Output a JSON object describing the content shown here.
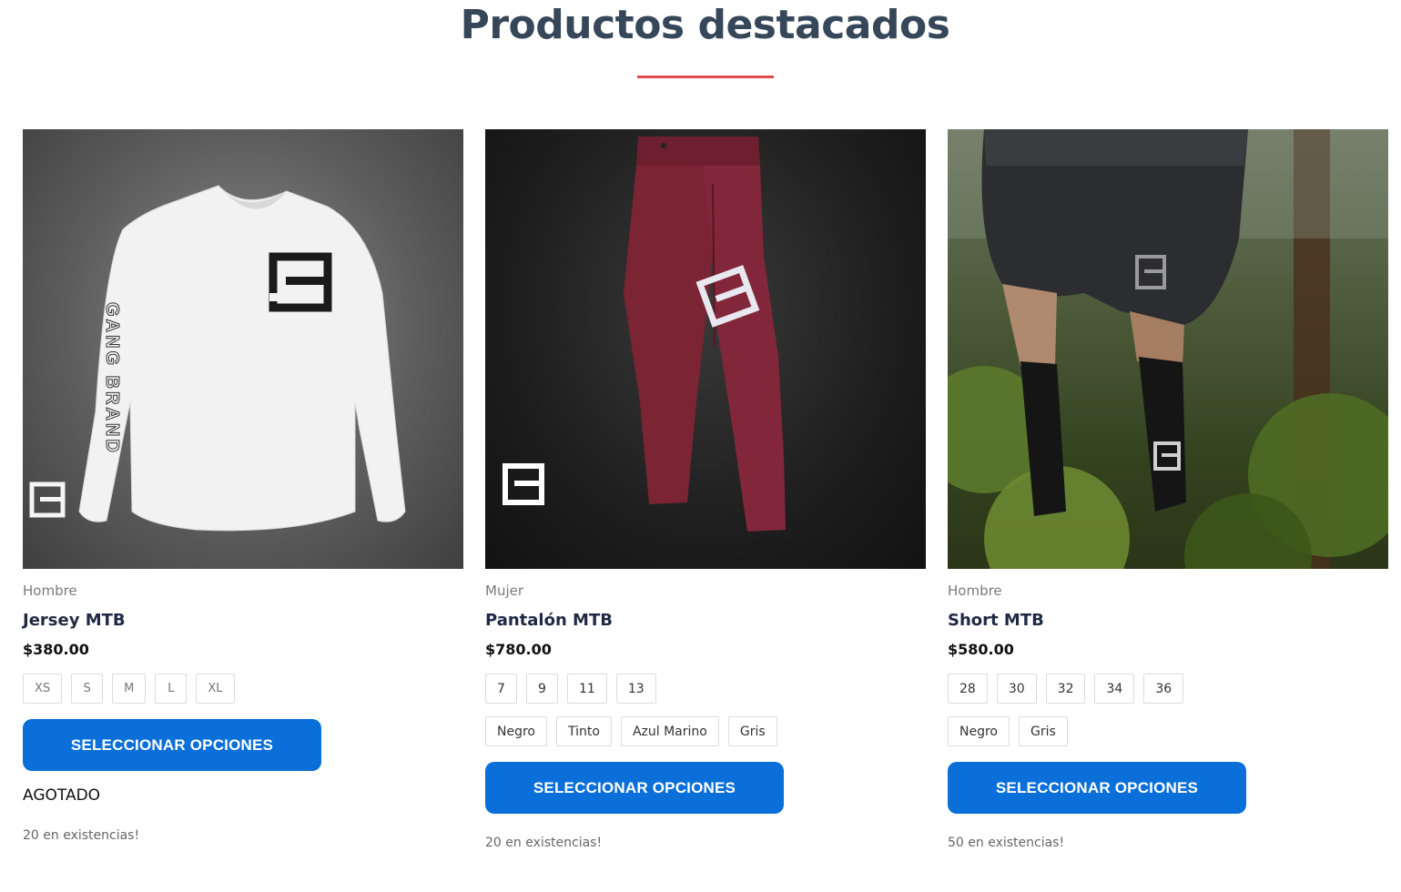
{
  "section": {
    "title": "Productos destacados",
    "accent_color": "#e14b4b",
    "button_color": "#0a6fd8"
  },
  "products": [
    {
      "category": "Hombre",
      "name": "Jersey MTB",
      "price": "$380.00",
      "option_rows": [
        [
          "XS",
          "S",
          "M",
          "L",
          "XL"
        ]
      ],
      "cta_label": "SELECCIONAR OPCIONES",
      "status": "AGOTADO",
      "stock": "20 en existencias!",
      "image": "white-long-sleeve-jersey-photo"
    },
    {
      "category": "Mujer",
      "name": "Pantalón MTB",
      "price": "$780.00",
      "option_rows": [
        [
          "7",
          "9",
          "11",
          "13"
        ],
        [
          "Negro",
          "Tinto",
          "Azul Marino",
          "Gris"
        ]
      ],
      "cta_label": "SELECCIONAR OPCIONES",
      "stock": "20 en existencias!",
      "image": "maroon-pants-photo"
    },
    {
      "category": "Hombre",
      "name": "Short MTB",
      "price": "$580.00",
      "option_rows": [
        [
          "28",
          "30",
          "32",
          "34",
          "36"
        ],
        [
          "Negro",
          "Gris"
        ]
      ],
      "cta_label": "SELECCIONAR OPCIONES",
      "stock": "50 en existencias!",
      "image": "black-shorts-outdoor-photo"
    }
  ]
}
